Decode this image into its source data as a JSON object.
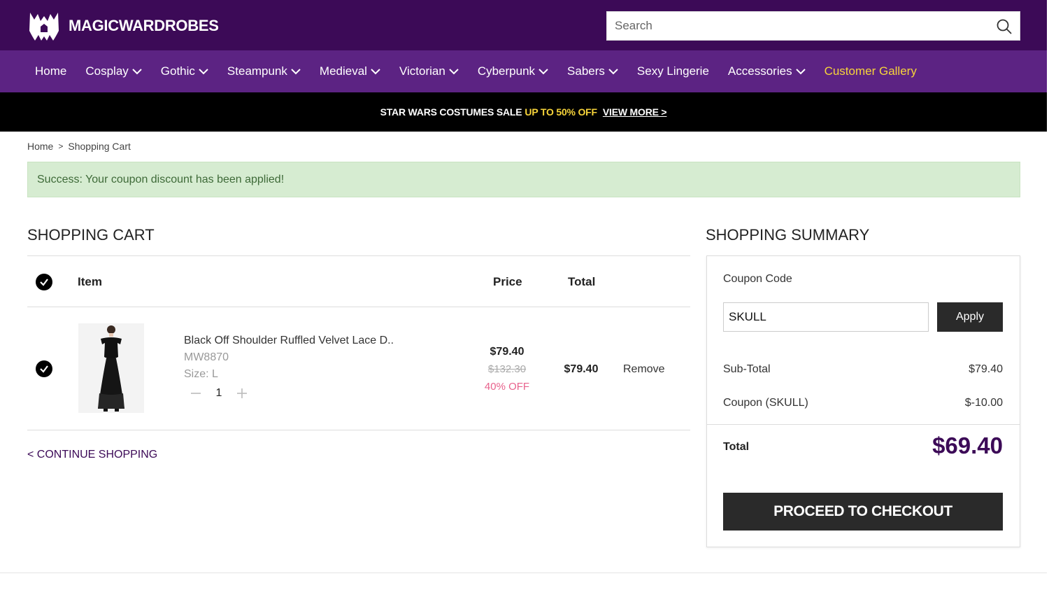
{
  "brand": {
    "name": "MAGICWARDROBES",
    "logo_icon": "bat-castle-logo",
    "colors": {
      "header": "#3c0a57",
      "nav": "#5c2383",
      "highlight": "#f7d43a",
      "discount": "#e8628c"
    }
  },
  "search": {
    "placeholder": "Search",
    "icon": "search-icon"
  },
  "nav": {
    "items": [
      {
        "label": "Home",
        "has_dropdown": false
      },
      {
        "label": "Cosplay",
        "has_dropdown": true
      },
      {
        "label": "Gothic",
        "has_dropdown": true
      },
      {
        "label": "Steampunk",
        "has_dropdown": true
      },
      {
        "label": "Medieval",
        "has_dropdown": true
      },
      {
        "label": "Victorian",
        "has_dropdown": true
      },
      {
        "label": "Cyberpunk",
        "has_dropdown": true
      },
      {
        "label": "Sabers",
        "has_dropdown": true
      },
      {
        "label": "Sexy Lingerie",
        "has_dropdown": false
      },
      {
        "label": "Accessories",
        "has_dropdown": true
      },
      {
        "label": "Customer Gallery",
        "has_dropdown": false,
        "highlight": true
      }
    ]
  },
  "promo": {
    "text": "STAR WARS COSTUMES SALE",
    "highlight": "UP TO 50% OFF",
    "link": "VIEW MORE >"
  },
  "breadcrumb": {
    "home": "Home",
    "separator": ">",
    "current": "Shopping Cart"
  },
  "alert": {
    "message": "Success: Your coupon discount has been applied!"
  },
  "cart": {
    "title": "SHOPPING CART",
    "headers": {
      "item": "Item",
      "price": "Price",
      "total": "Total"
    },
    "items": [
      {
        "name": "Black Off Shoulder Ruffled Velvet Lace D..",
        "sku": "MW8870",
        "size": "Size: L",
        "quantity": "1",
        "price": "$79.40",
        "original_price": "$132.30",
        "discount": "40% OFF",
        "total": "$79.40",
        "remove_label": "Remove",
        "selected": true
      }
    ],
    "continue_label": "< CONTINUE SHOPPING"
  },
  "summary": {
    "title": "SHOPPING SUMMARY",
    "coupon_label": "Coupon Code",
    "coupon_value": "SKULL",
    "apply_label": "Apply",
    "subtotal_label": "Sub-Total",
    "subtotal_value": "$79.40",
    "coupon_line_label": "Coupon (SKULL)",
    "coupon_line_value": "$-10.00",
    "total_label": "Total",
    "total_value": "$69.40",
    "checkout_label": "PROCEED TO CHECKOUT"
  }
}
